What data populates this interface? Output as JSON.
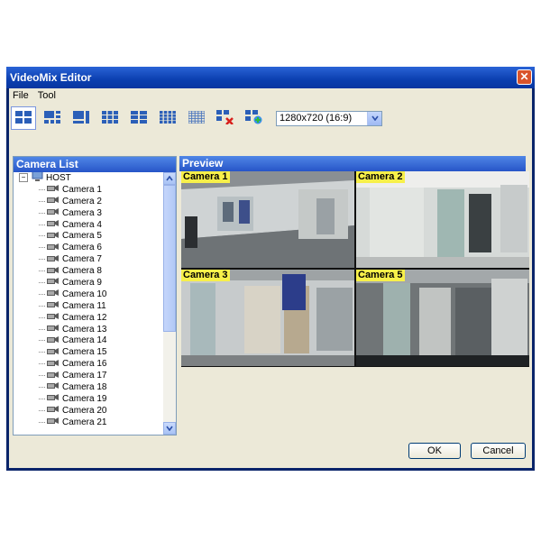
{
  "window": {
    "title": "VideoMix Editor",
    "close_glyph": "✕"
  },
  "menu": [
    "File",
    "Tool"
  ],
  "toolbar": {
    "buttons": [
      "layout-2x2-icon",
      "layout-3-plus-icon",
      "layout-1-plus-icon",
      "layout-3x3-icon",
      "layout-4x3-icon",
      "layout-4x4-icon",
      "layout-5x5-icon",
      "delete-camera-icon",
      "add-camera-icon"
    ],
    "resolution": "1280x720 (16:9)"
  },
  "camera_list": {
    "title": "Camera List",
    "host": "HOST",
    "items": [
      "Camera 1",
      "Camera 2",
      "Camera 3",
      "Camera 4",
      "Camera 5",
      "Camera 6",
      "Camera 7",
      "Camera 8",
      "Camera 9",
      "Camera 10",
      "Camera 11",
      "Camera 12",
      "Camera 13",
      "Camera 14",
      "Camera 15",
      "Camera 16",
      "Camera 17",
      "Camera 18",
      "Camera 19",
      "Camera 20",
      "Camera 21"
    ]
  },
  "preview": {
    "title": "Preview",
    "tiles": [
      "Camera 1",
      "Camera 2",
      "Camera 3",
      "Camera 5"
    ]
  },
  "buttons": {
    "ok": "OK",
    "cancel": "Cancel"
  }
}
